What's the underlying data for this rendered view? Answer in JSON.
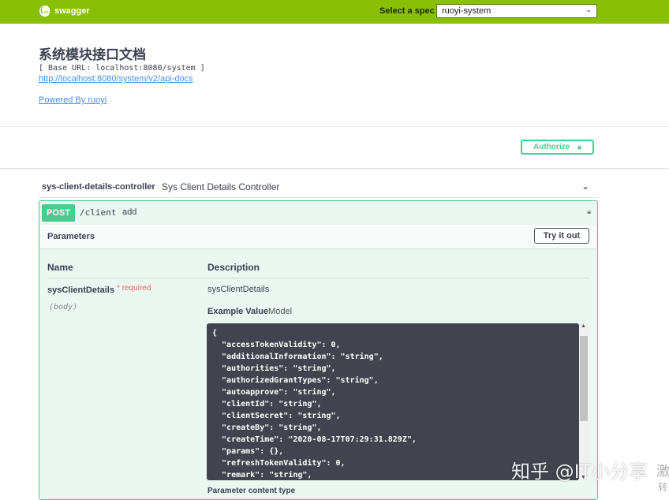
{
  "topbar": {
    "logo_mark": "{…}",
    "logo_text": "swagger",
    "spec_label": "Select a spec",
    "spec_value": "ruoyi-system",
    "colors": {
      "topbar": "#89bf04"
    }
  },
  "info": {
    "title": "系统模块接口文档",
    "base_url": "[ Base URL: localhost:8080/system ]",
    "api_docs_link": "http://localhost:8080/system/v2/api-docs",
    "powered_by": "Powered By ruoyi"
  },
  "authorize": {
    "label": "Authorize",
    "icon": "lock-icon"
  },
  "tag": {
    "name": "sys-client-details-controller",
    "description": "Sys Client Details Controller",
    "icon": "chevron-down-icon"
  },
  "operation": {
    "method": "POST",
    "path": "/client",
    "summary": "add",
    "colors": {
      "post": "#49cc90"
    },
    "parameters_title": "Parameters",
    "try_it_out": "Try it out",
    "columns": {
      "name": "Name",
      "description": "Description"
    },
    "param": {
      "name": "sysClientDetails",
      "required": "* required",
      "in": "(body)",
      "description": "sysClientDetails"
    },
    "example_tab": "Example Value",
    "model_tab": "Model",
    "example_json": "{\n  \"accessTokenValidity\": 0,\n  \"additionalInformation\": \"string\",\n  \"authorities\": \"string\",\n  \"authorizedGrantTypes\": \"string\",\n  \"autoapprove\": \"string\",\n  \"clientId\": \"string\",\n  \"clientSecret\": \"string\",\n  \"createBy\": \"string\",\n  \"createTime\": \"2020-08-17T07:29:31.829Z\",\n  \"params\": {},\n  \"refreshTokenValidity\": 0,\n  \"remark\": \"string\",",
    "content_type_label": "Parameter content type"
  },
  "watermark": {
    "text": "知乎 @IT小分享",
    "side_text": "激",
    "side_text2": "转"
  }
}
